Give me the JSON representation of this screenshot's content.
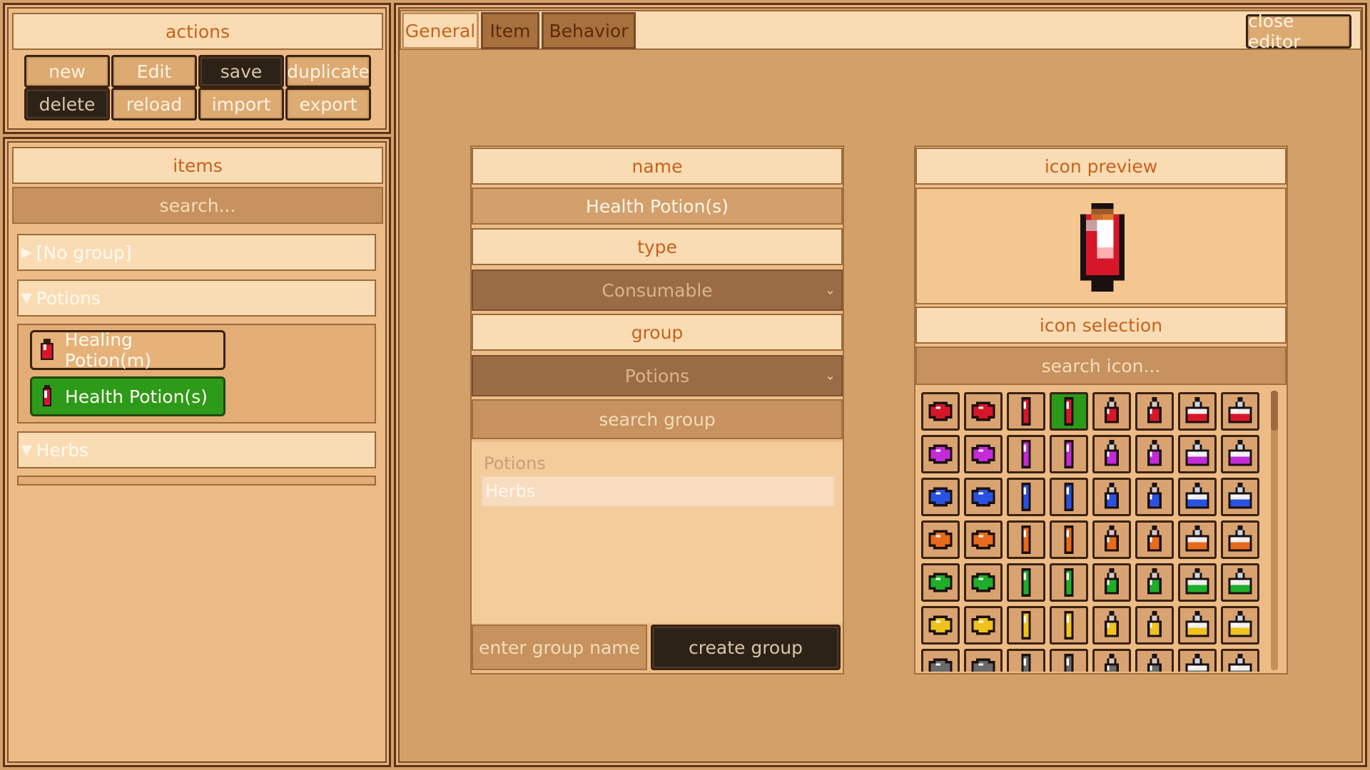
{
  "actions": {
    "title": "actions",
    "buttons": {
      "new": "new",
      "edit": "Edit",
      "save": "save",
      "duplicate": "duplicate",
      "delete": "delete",
      "reload": "reload",
      "import": "import",
      "export": "export"
    }
  },
  "items_panel": {
    "title": "items",
    "search_placeholder": "search...",
    "groups": [
      {
        "label": "[No group]",
        "expanded": false
      },
      {
        "label": "Potions",
        "expanded": true,
        "items": [
          "Healing Potion(m)",
          "Health Potion(s)"
        ],
        "selected": "Health Potion(s)"
      },
      {
        "label": "Herbs",
        "expanded": true
      }
    ]
  },
  "tabs": {
    "general": "General",
    "item": "Item",
    "behavior": "Behavior",
    "active": "General"
  },
  "close_editor": "close editor",
  "form": {
    "name_label": "name",
    "name_value": "Health Potion(s)",
    "type_label": "type",
    "type_value": "Consumable",
    "group_label": "group",
    "group_value": "Potions",
    "group_search_placeholder": "search group",
    "group_options": [
      "Potions",
      "Herbs"
    ],
    "group_option_highlighted": "Herbs",
    "new_group_placeholder": "enter group name",
    "create_group_label": "create group"
  },
  "icon_panel": {
    "preview_label": "icon preview",
    "selection_label": "icon selection",
    "search_placeholder": "search icon...",
    "rows": [
      "red",
      "purple",
      "blue",
      "orange",
      "green",
      "yellow",
      "gray"
    ],
    "colors": {
      "red": "#d8162a",
      "purple": "#c42ad8",
      "blue": "#2a52e0",
      "orange": "#e86a1c",
      "green": "#1fae2a",
      "yellow": "#f0c21e",
      "gray": "#6a6a6a"
    },
    "selected_row": 0,
    "selected_col": 3
  },
  "theme": {
    "background": "#d4a06a",
    "panel": "#edbc86",
    "header": "#fadcb4",
    "accent_text": "#c8611c",
    "selected_green": "#2e9a1a",
    "dark_button": "#2c2218"
  }
}
